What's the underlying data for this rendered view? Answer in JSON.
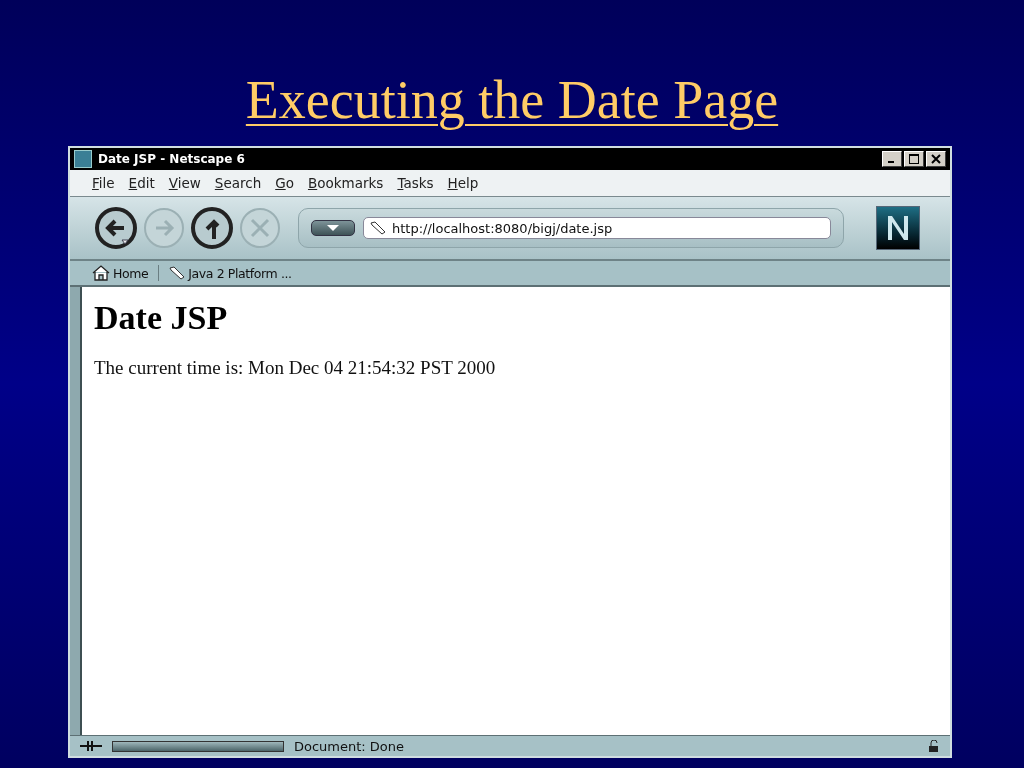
{
  "slide": {
    "title": "Executing the Date Page"
  },
  "window": {
    "title": "Date JSP - Netscape 6"
  },
  "menu": [
    {
      "label": "File"
    },
    {
      "label": "Edit"
    },
    {
      "label": "View"
    },
    {
      "label": "Search"
    },
    {
      "label": "Go"
    },
    {
      "label": "Bookmarks"
    },
    {
      "label": "Tasks"
    },
    {
      "label": "Help"
    }
  ],
  "nav_buttons": [
    {
      "kind": "back",
      "disabled": false
    },
    {
      "kind": "forward",
      "disabled": true
    },
    {
      "kind": "reload",
      "disabled": false
    },
    {
      "kind": "stop",
      "disabled": true
    }
  ],
  "address": {
    "value": "http://localhost:8080/bigj/date.jsp"
  },
  "personal_bar": [
    {
      "kind": "home",
      "label": "Home"
    },
    {
      "kind": "bookmark",
      "label": "Java 2 Platform ..."
    }
  ],
  "page": {
    "heading": "Date JSP",
    "text": "The current time is: Mon Dec 04 21:54:32 PST 2000"
  },
  "status_bar": {
    "text": "Document: Done",
    "progress": {
      "level": 1
    }
  }
}
